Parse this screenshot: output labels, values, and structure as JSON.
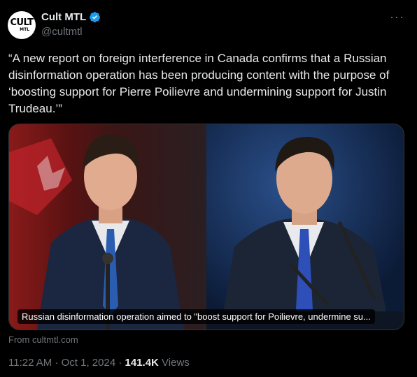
{
  "author": {
    "avatar_text_top": "CULT",
    "avatar_text_bottom": "MTL",
    "display_name": "Cult MTL",
    "handle": "@cultmtl",
    "verified_color": "#1d9bf0"
  },
  "more_icon": "more-horizontal-icon",
  "tweet": {
    "text": "“A new report on foreign interference in Canada confirms that a Russian disinformation operation has been producing content with the purpose of ‘boosting support for Pierre Poilievre and undermining support for Justin Trudeau.’”"
  },
  "card": {
    "caption": "Russian disinformation operation aimed to \"boost support for Poilievre, undermine su...",
    "source": "From cultmtl.com"
  },
  "meta": {
    "time": "11:22 AM",
    "separator": " · ",
    "date": "Oct 1, 2024",
    "views_count": "141.4K",
    "views_label": " Views"
  }
}
